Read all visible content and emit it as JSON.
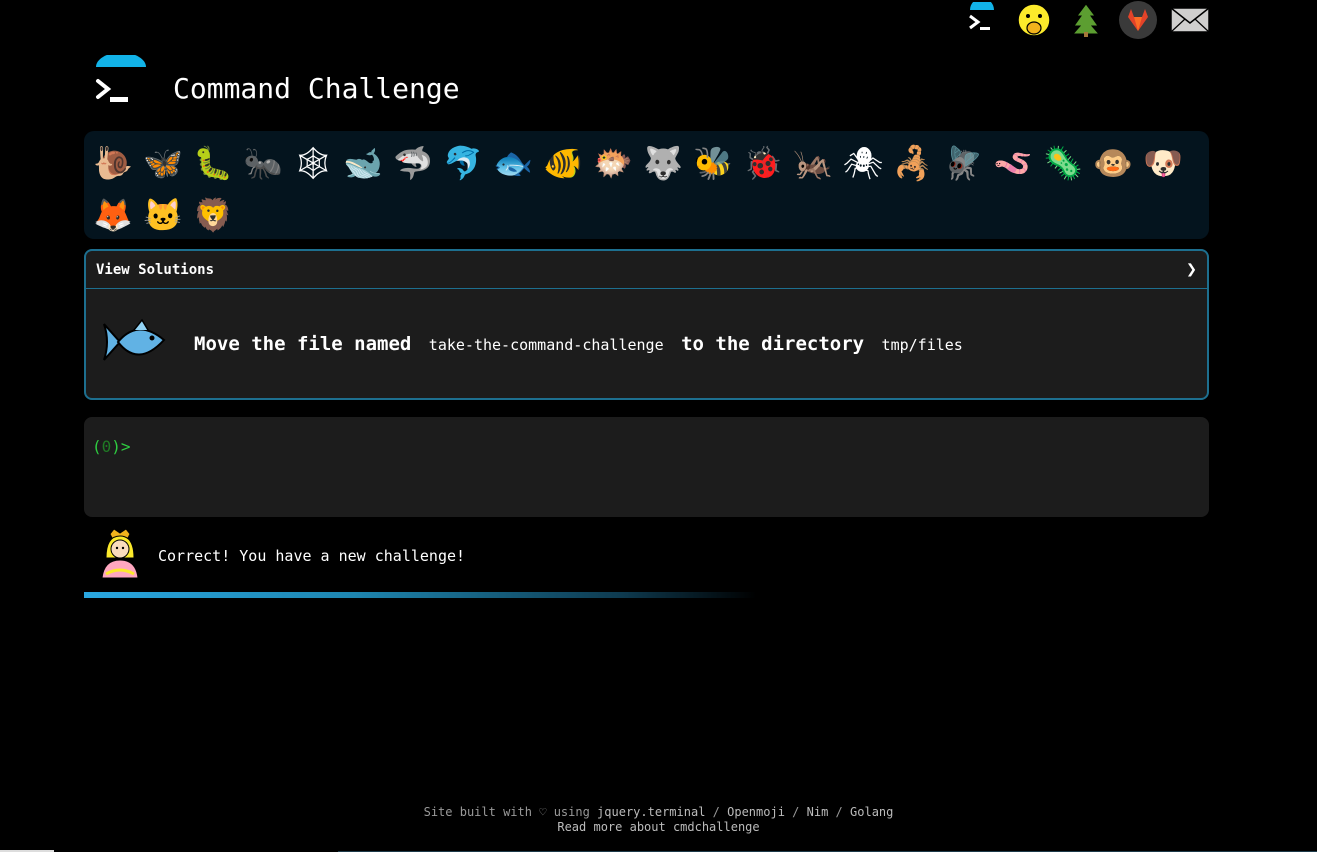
{
  "header": {
    "title": "Command Challenge"
  },
  "topbar": {
    "icons": [
      "terminal-icon",
      "face-with-hand-over-mouth-icon",
      "tree-icon",
      "gitlab-icon",
      "envelope-icon"
    ]
  },
  "animals": [
    {
      "icon": "snail-icon",
      "glyph": "🐌"
    },
    {
      "icon": "butterfly-icon",
      "glyph": "🦋"
    },
    {
      "icon": "caterpillar-icon",
      "glyph": "🐛"
    },
    {
      "icon": "ant-icon",
      "glyph": "🐜"
    },
    {
      "icon": "spider-web-icon",
      "glyph": "🕸"
    },
    {
      "icon": "whale-icon",
      "glyph": "🐋"
    },
    {
      "icon": "shark-icon",
      "glyph": "🦈"
    },
    {
      "icon": "dolphin-icon",
      "glyph": "🐬"
    },
    {
      "icon": "fish-icon",
      "glyph": "🐟"
    },
    {
      "icon": "tropical-fish-icon",
      "glyph": "🐠"
    },
    {
      "icon": "blowfish-icon",
      "glyph": "🐡"
    },
    {
      "icon": "wolf-icon",
      "glyph": "🐺"
    },
    {
      "icon": "bee-icon",
      "glyph": "🐝"
    },
    {
      "icon": "lady-beetle-icon",
      "glyph": "🐞"
    },
    {
      "icon": "cricket-icon",
      "glyph": "🦗"
    },
    {
      "icon": "spider-icon",
      "glyph": "🕷"
    },
    {
      "icon": "scorpion-icon",
      "glyph": "🦂"
    },
    {
      "icon": "fly-icon",
      "glyph": "🪰"
    },
    {
      "icon": "worm-icon",
      "glyph": "🪱"
    },
    {
      "icon": "microbe-icon",
      "glyph": "🦠"
    },
    {
      "icon": "monkey-face-icon",
      "glyph": "🐵"
    },
    {
      "icon": "dog-face-icon",
      "glyph": "🐶"
    },
    {
      "icon": "fox-icon",
      "glyph": "🦊"
    },
    {
      "icon": "cat-face-icon",
      "glyph": "🐱"
    },
    {
      "icon": "lion-icon",
      "glyph": "🦁"
    }
  ],
  "challenge": {
    "header": "View Solutions",
    "chevron": "❯",
    "text_before": "Move the file named",
    "file": "take-the-command-challenge",
    "text_middle": "to the directory",
    "dir": "tmp/files"
  },
  "terminal": {
    "prompt_open": "(",
    "prompt_count": "0",
    "prompt_close": ")>"
  },
  "status": {
    "message": "Correct! You have a new challenge!"
  },
  "progress": {
    "fraction": 0.52
  },
  "footer": {
    "line1_prefix": "Site built with",
    "heart": "♡",
    "line1_using": "using",
    "link_terminal": "jquery.terminal",
    "sep1": "/",
    "link_openmoji": "Openmoji",
    "sep2": "/",
    "link_nim": "Nim",
    "sep3": "/",
    "link_golang": "Golang",
    "line2": "Read more about cmdchallenge"
  }
}
